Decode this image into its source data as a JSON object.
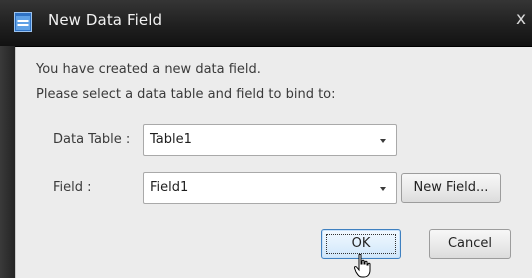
{
  "window": {
    "title": "New Data Field",
    "close_glyph": "x"
  },
  "message": {
    "line1": "You have created a new data field.",
    "line2": "Please select a data table and field to bind to:"
  },
  "data_table": {
    "label": "Data Table :",
    "value": "Table1"
  },
  "field": {
    "label": "Field :",
    "value": "Field1"
  },
  "buttons": {
    "new_field": "New Field...",
    "ok": "OK",
    "cancel": "Cancel"
  },
  "icons": {
    "app": "form-window-icon",
    "dropdown": "chevron-down-icon",
    "cursor": "hand-pointer-icon"
  },
  "colors": {
    "titlebar": "#202020",
    "dialog_bg": "#ececec",
    "default_button_border": "#3f80c0",
    "app_icon": "#3a7fd0"
  }
}
